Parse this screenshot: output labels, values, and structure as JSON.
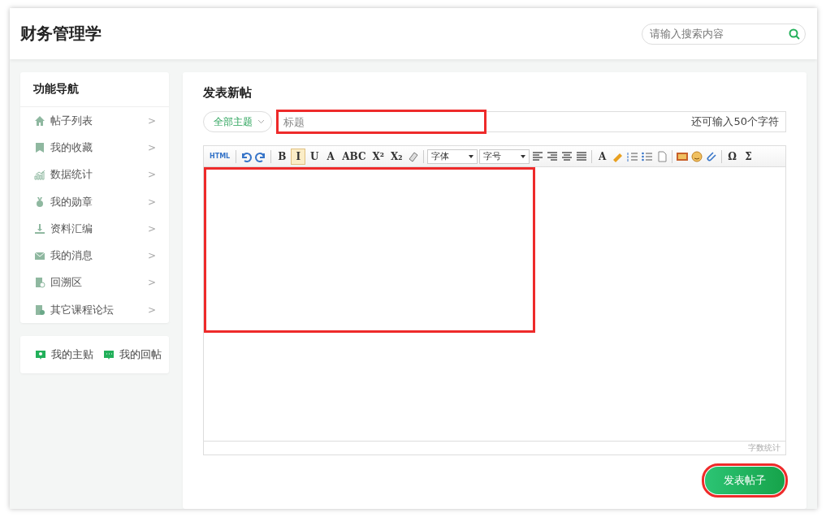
{
  "header": {
    "title": "财务管理学",
    "search": {
      "placeholder": "请输入搜索内容"
    }
  },
  "sidebar": {
    "title": "功能导航",
    "items": [
      {
        "label": "帖子列表",
        "arrow": ">"
      },
      {
        "label": "我的收藏",
        "arrow": ">"
      },
      {
        "label": "数据统计",
        "arrow": ">"
      },
      {
        "label": "我的勋章",
        "arrow": ">"
      },
      {
        "label": "资料汇编",
        "arrow": ">"
      },
      {
        "label": "我的消息",
        "arrow": ">"
      },
      {
        "label": "回溯区",
        "arrow": ">"
      },
      {
        "label": "其它课程论坛",
        "arrow": ">"
      }
    ],
    "links": [
      {
        "label": "我的主贴"
      },
      {
        "label": "我的回帖"
      }
    ]
  },
  "compose": {
    "title": "发表新帖",
    "topic": {
      "label": "全部主题"
    },
    "title_field": {
      "placeholder": "标题",
      "counter": "还可输入50个字符",
      "highlighted": true
    },
    "toolbar": [
      {
        "kind": "glyph",
        "label": "HTML",
        "selected": false
      },
      {
        "kind": "sep"
      },
      {
        "kind": "icon"
      },
      {
        "kind": "icon"
      },
      {
        "kind": "sep"
      },
      {
        "kind": "glyph",
        "label": "B",
        "selected": false
      },
      {
        "kind": "glyph",
        "label": "I",
        "selected": true
      },
      {
        "kind": "glyph",
        "label": "U",
        "selected": false
      },
      {
        "kind": "glyph",
        "label": "A",
        "selected": false
      },
      {
        "kind": "glyph",
        "label": "ABC",
        "selected": false
      },
      {
        "kind": "glyph",
        "label": "X²",
        "selected": false
      },
      {
        "kind": "glyph",
        "label": "X₂",
        "selected": false
      },
      {
        "kind": "icon"
      },
      {
        "kind": "sep"
      },
      {
        "kind": "select",
        "label": "字体"
      },
      {
        "kind": "select",
        "label": "字号"
      },
      {
        "kind": "icon"
      },
      {
        "kind": "icon"
      },
      {
        "kind": "icon"
      },
      {
        "kind": "icon"
      },
      {
        "kind": "sep"
      },
      {
        "kind": "glyph",
        "label": "A",
        "selected": false
      },
      {
        "kind": "icon"
      },
      {
        "kind": "icon"
      },
      {
        "kind": "icon"
      },
      {
        "kind": "icon"
      },
      {
        "kind": "sep"
      },
      {
        "kind": "icon"
      },
      {
        "kind": "icon"
      },
      {
        "kind": "icon"
      },
      {
        "kind": "sep"
      },
      {
        "kind": "glyph",
        "label": "Ω",
        "selected": false
      },
      {
        "kind": "glyph",
        "label": "Σ",
        "selected": false
      }
    ],
    "editor": {
      "highlighted": true,
      "word_count": "字数统计"
    },
    "submit": {
      "label": "发表帖子",
      "highlighted": true
    }
  }
}
